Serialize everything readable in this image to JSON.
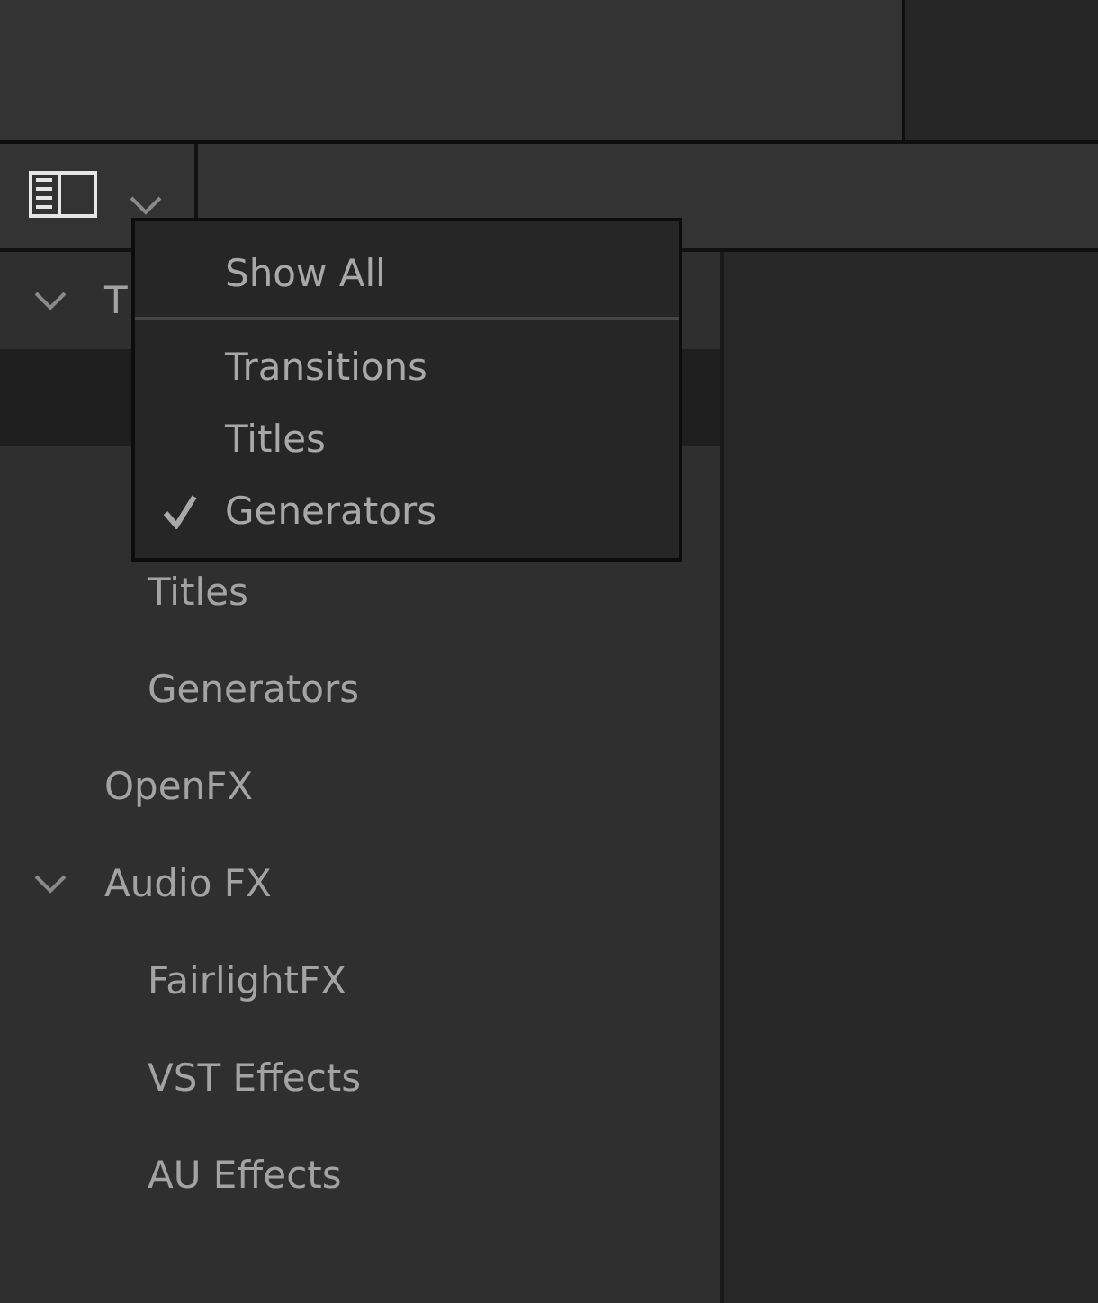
{
  "menu": {
    "items": [
      {
        "label": "Show All",
        "kind": "item",
        "checked": false
      },
      {
        "kind": "separator"
      },
      {
        "label": "Transitions",
        "kind": "item",
        "checked": false
      },
      {
        "label": "Titles",
        "kind": "item",
        "checked": false
      },
      {
        "label": "Generators",
        "kind": "item",
        "checked": true
      }
    ]
  },
  "tree": [
    {
      "label": "T",
      "expanded": true,
      "selected": false,
      "children": [
        {
          "selected": true
        },
        {
          "selected": false
        },
        {
          "label": "Titles",
          "selected": false
        },
        {
          "label": "Generators",
          "selected": false
        }
      ]
    },
    {
      "label": "OpenFX",
      "selected": false
    },
    {
      "label": "Audio FX",
      "expanded": true,
      "selected": false,
      "children": [
        {
          "label": "FairlightFX",
          "selected": false
        },
        {
          "label": "VST Effects",
          "selected": false
        },
        {
          "label": "AU Effects",
          "selected": false
        }
      ]
    }
  ]
}
